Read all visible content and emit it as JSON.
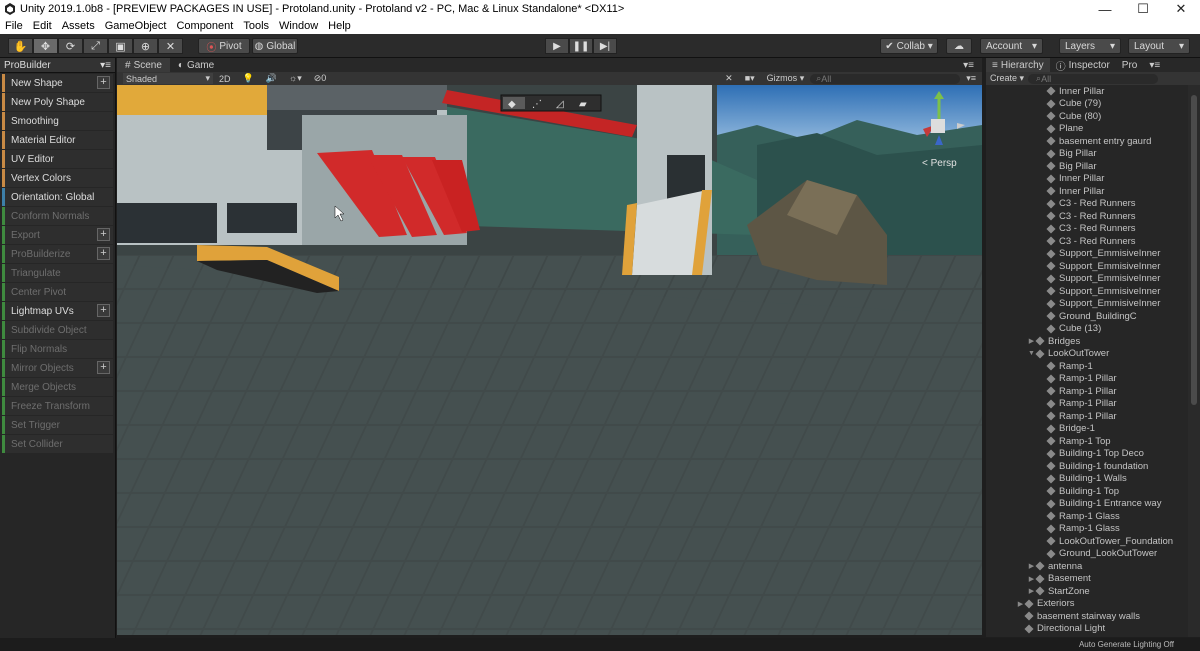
{
  "window": {
    "title": "Unity 2019.1.0b8 - [PREVIEW PACKAGES IN USE] - Protoland.unity - Protoland v2 - PC, Mac & Linux Standalone* <DX11>"
  },
  "menu": [
    "File",
    "Edit",
    "Assets",
    "GameObject",
    "Component",
    "Tools",
    "Window",
    "Help"
  ],
  "toolbar": {
    "pivot": "Pivot",
    "global": "Global",
    "collab": "Collab",
    "account": "Account",
    "layers": "Layers",
    "layout": "Layout"
  },
  "probuilder": {
    "tab": "ProBuilder",
    "items": [
      {
        "label": "New Shape",
        "color": "orange",
        "plus": true,
        "dim": false
      },
      {
        "label": "New Poly Shape",
        "color": "orange",
        "plus": false,
        "dim": false
      },
      {
        "label": "Smoothing",
        "color": "orange",
        "plus": false,
        "dim": false
      },
      {
        "label": "Material Editor",
        "color": "orange",
        "plus": false,
        "dim": false
      },
      {
        "label": "UV Editor",
        "color": "orange",
        "plus": false,
        "dim": false
      },
      {
        "label": "Vertex Colors",
        "color": "orange",
        "plus": false,
        "dim": false
      },
      {
        "label": "Orientation: Global",
        "color": "blue",
        "plus": false,
        "dim": false
      },
      {
        "label": "Conform Normals",
        "color": "green",
        "plus": false,
        "dim": true
      },
      {
        "label": "Export",
        "color": "green",
        "plus": true,
        "dim": true
      },
      {
        "label": "ProBuilderize",
        "color": "green",
        "plus": true,
        "dim": true
      },
      {
        "label": "Triangulate",
        "color": "green",
        "plus": false,
        "dim": true
      },
      {
        "label": "Center Pivot",
        "color": "green",
        "plus": false,
        "dim": true
      },
      {
        "label": "Lightmap UVs",
        "color": "green",
        "plus": true,
        "dim": false
      },
      {
        "label": "Subdivide Object",
        "color": "green",
        "plus": false,
        "dim": true
      },
      {
        "label": "Flip Normals",
        "color": "green",
        "plus": false,
        "dim": true
      },
      {
        "label": "Mirror Objects",
        "color": "green",
        "plus": true,
        "dim": true
      },
      {
        "label": "Merge Objects",
        "color": "green",
        "plus": false,
        "dim": true
      },
      {
        "label": "Freeze Transform",
        "color": "green",
        "plus": false,
        "dim": true
      },
      {
        "label": "Set Trigger",
        "color": "green",
        "plus": false,
        "dim": true
      },
      {
        "label": "Set Collider",
        "color": "green",
        "plus": false,
        "dim": true
      }
    ]
  },
  "scene": {
    "tab_scene": "Scene",
    "tab_game": "Game",
    "shading": "Shaded",
    "mode_2d": "2D",
    "fx_count": "0",
    "gizmos": "Gizmos",
    "search_placeholder": "All",
    "persp": "< Persp"
  },
  "right": {
    "tab_hierarchy": "Hierarchy",
    "tab_inspector": "Inspector",
    "tab_pro": "Pro",
    "create": "Create",
    "search_placeholder": "All"
  },
  "hierarchy": [
    {
      "indent": 2,
      "arrow": "",
      "label": "Inner Pillar"
    },
    {
      "indent": 2,
      "arrow": "",
      "label": "Cube (79)"
    },
    {
      "indent": 2,
      "arrow": "",
      "label": "Cube (80)"
    },
    {
      "indent": 2,
      "arrow": "",
      "label": "Plane"
    },
    {
      "indent": 2,
      "arrow": "",
      "label": "basement entry gaurd"
    },
    {
      "indent": 2,
      "arrow": "",
      "label": "Big Pillar"
    },
    {
      "indent": 2,
      "arrow": "",
      "label": "Big Pillar"
    },
    {
      "indent": 2,
      "arrow": "",
      "label": "Inner Pillar"
    },
    {
      "indent": 2,
      "arrow": "",
      "label": "Inner Pillar"
    },
    {
      "indent": 2,
      "arrow": "",
      "label": "C3 - Red Runners"
    },
    {
      "indent": 2,
      "arrow": "",
      "label": "C3 - Red Runners"
    },
    {
      "indent": 2,
      "arrow": "",
      "label": "C3 - Red Runners"
    },
    {
      "indent": 2,
      "arrow": "",
      "label": "C3 - Red Runners"
    },
    {
      "indent": 2,
      "arrow": "",
      "label": "Support_EmmisiveInner"
    },
    {
      "indent": 2,
      "arrow": "",
      "label": "Support_EmmisiveInner"
    },
    {
      "indent": 2,
      "arrow": "",
      "label": "Support_EmmisiveInner"
    },
    {
      "indent": 2,
      "arrow": "",
      "label": "Support_EmmisiveInner"
    },
    {
      "indent": 2,
      "arrow": "",
      "label": "Support_EmmisiveInner"
    },
    {
      "indent": 2,
      "arrow": "",
      "label": "Ground_BuildingC"
    },
    {
      "indent": 2,
      "arrow": "",
      "label": "Cube (13)"
    },
    {
      "indent": 1,
      "arrow": "▶",
      "label": "Bridges"
    },
    {
      "indent": 1,
      "arrow": "▼",
      "label": "LookOutTower"
    },
    {
      "indent": 2,
      "arrow": "",
      "label": "Ramp-1"
    },
    {
      "indent": 2,
      "arrow": "",
      "label": "Ramp-1 Pillar"
    },
    {
      "indent": 2,
      "arrow": "",
      "label": "Ramp-1 Pillar"
    },
    {
      "indent": 2,
      "arrow": "",
      "label": "Ramp-1 Pillar"
    },
    {
      "indent": 2,
      "arrow": "",
      "label": "Ramp-1 Pillar"
    },
    {
      "indent": 2,
      "arrow": "",
      "label": "Bridge-1"
    },
    {
      "indent": 2,
      "arrow": "",
      "label": "Ramp-1 Top"
    },
    {
      "indent": 2,
      "arrow": "",
      "label": "Building-1 Top Deco"
    },
    {
      "indent": 2,
      "arrow": "",
      "label": "Building-1 foundation"
    },
    {
      "indent": 2,
      "arrow": "",
      "label": "Building-1 Walls"
    },
    {
      "indent": 2,
      "arrow": "",
      "label": "Building-1 Top"
    },
    {
      "indent": 2,
      "arrow": "",
      "label": "Building-1 Entrance way"
    },
    {
      "indent": 2,
      "arrow": "",
      "label": "Ramp-1 Glass"
    },
    {
      "indent": 2,
      "arrow": "",
      "label": "Ramp-1 Glass"
    },
    {
      "indent": 2,
      "arrow": "",
      "label": "LookOutTower_Foundation"
    },
    {
      "indent": 2,
      "arrow": "",
      "label": "Ground_LookOutTower"
    },
    {
      "indent": 1,
      "arrow": "▶",
      "label": "antenna"
    },
    {
      "indent": 1,
      "arrow": "▶",
      "label": "Basement"
    },
    {
      "indent": 1,
      "arrow": "▶",
      "label": "StartZone"
    },
    {
      "indent": 0,
      "arrow": "▶",
      "label": "Exteriors"
    },
    {
      "indent": 0,
      "arrow": "",
      "label": "basement stairway walls"
    },
    {
      "indent": 0,
      "arrow": "",
      "label": "Directional Light"
    }
  ],
  "status": {
    "text": "Auto Generate Lighting Off"
  },
  "colors": {
    "accent_orange": "#c88a45",
    "accent_blue": "#3d7fa8",
    "accent_green": "#3f8a3f"
  }
}
